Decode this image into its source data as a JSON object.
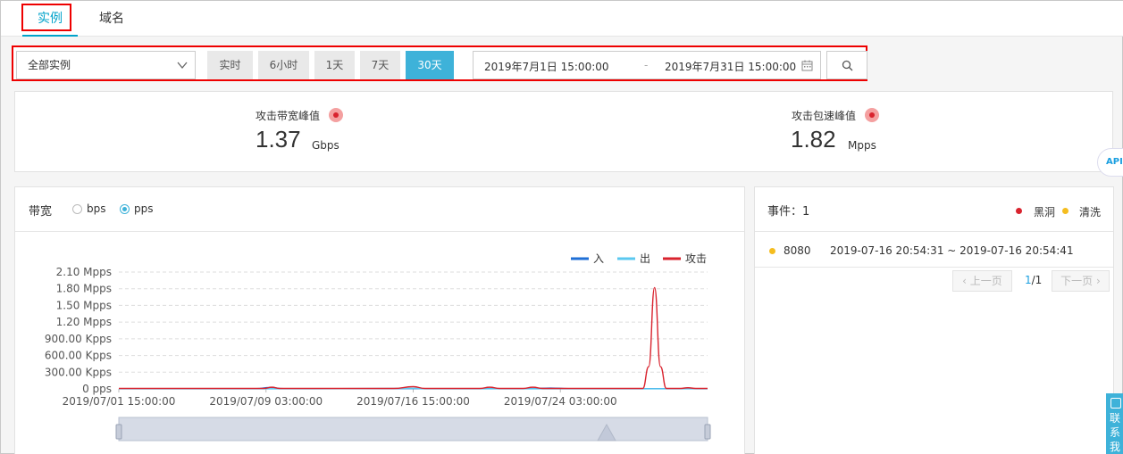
{
  "tabs": [
    {
      "label": "实例"
    },
    {
      "label": "域名"
    }
  ],
  "toolbar": {
    "instance_select": "全部实例",
    "ranges": [
      "实时",
      "6小时",
      "1天",
      "7天",
      "30天"
    ],
    "active_range": "30天",
    "date_start": "2019年7月1日 15:00:00",
    "date_sep": "-",
    "date_end": "2019年7月31日 15:00:00"
  },
  "stats": {
    "bandwidth": {
      "label": "攻击带宽峰值",
      "value": "1.37",
      "unit": "Gbps"
    },
    "packets": {
      "label": "攻击包速峰值",
      "value": "1.82",
      "unit": "Mpps"
    }
  },
  "api_tab": "API",
  "bandwidth_panel": {
    "title": "带宽",
    "options": [
      "bps",
      "pps"
    ],
    "selected": "pps"
  },
  "chart_data": {
    "type": "line",
    "y_ticks": [
      "2.10 Mpps",
      "1.80 Mpps",
      "1.50 Mpps",
      "1.20 Mpps",
      "900.00 Kpps",
      "600.00 Kpps",
      "300.00 Kpps",
      "0 pps"
    ],
    "y_values": [
      2100000,
      1800000,
      1500000,
      1200000,
      900000,
      600000,
      300000,
      0
    ],
    "ylim": [
      0,
      2100000
    ],
    "x_ticks": [
      "2019/07/01 15:00:00",
      "2019/07/09 03:00:00",
      "2019/07/16 15:00:00",
      "2019/07/24 03:00:00"
    ],
    "x_tick_days": [
      0,
      7.5,
      15,
      22.5
    ],
    "xlim_days": [
      0,
      30
    ],
    "grid": true,
    "legend_position": "top-right",
    "series": [
      {
        "name": "入",
        "color": "#1f6fd6",
        "points": [
          [
            0,
            5000
          ],
          [
            7,
            5000
          ],
          [
            7.7,
            25000
          ],
          [
            8.4,
            5000
          ],
          [
            21,
            5000
          ],
          [
            22,
            15000
          ],
          [
            23,
            5000
          ],
          [
            30,
            5000
          ]
        ]
      },
      {
        "name": "出",
        "color": "#5bc8f0",
        "points": [
          [
            0,
            2000
          ],
          [
            10,
            2000
          ],
          [
            15.2,
            10000
          ],
          [
            15.5,
            2000
          ],
          [
            30,
            2000
          ]
        ]
      },
      {
        "name": "攻击",
        "color": "#d9232e",
        "points": [
          [
            0,
            8000
          ],
          [
            7.4,
            8000
          ],
          [
            7.8,
            30000
          ],
          [
            8.2,
            8000
          ],
          [
            14,
            8000
          ],
          [
            15,
            40000
          ],
          [
            15.6,
            8000
          ],
          [
            18.4,
            8000
          ],
          [
            18.9,
            30000
          ],
          [
            19.4,
            8000
          ],
          [
            20.6,
            8000
          ],
          [
            21.1,
            30000
          ],
          [
            21.6,
            8000
          ],
          [
            26.7,
            8000
          ],
          [
            27.0,
            400000
          ],
          [
            27.3,
            1820000
          ],
          [
            27.6,
            400000
          ],
          [
            27.9,
            8000
          ],
          [
            28.6,
            8000
          ],
          [
            29,
            20000
          ],
          [
            29.4,
            8000
          ],
          [
            30,
            8000
          ]
        ]
      }
    ]
  },
  "events_panel": {
    "title": "事件：1",
    "legend": [
      {
        "label": "黑洞",
        "color": "#d9232e"
      },
      {
        "label": "清洗",
        "color": "#f5bd1f"
      }
    ],
    "rows": [
      {
        "port": "8080",
        "time": "2019-07-16 20:54:31 ~ 2019-07-16 20:54:41",
        "color": "#f5bd1f"
      }
    ],
    "pager": {
      "prev": "上一页",
      "current": "1",
      "total": "/1",
      "next": "下一页"
    }
  },
  "contact_tab": "联系我"
}
